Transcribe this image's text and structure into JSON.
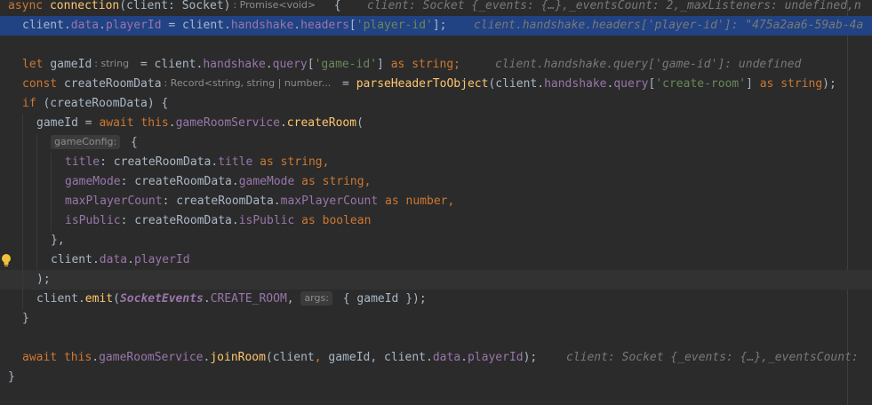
{
  "editor": {
    "code": {
      "l1": {
        "async": "async ",
        "fn": "connection",
        "params": "(client: Socket)",
        "hint": ": Promise<void>",
        "brace": "  {",
        "debug": "client: Socket {_events: {…},_eventsCount: 2,_maxListeners: undefined,n"
      },
      "l2": {
        "a": "client.",
        "b": "data",
        "c": ".",
        "d": "playerId",
        "e": " = client.",
        "f": "handshake",
        "g": ".",
        "h": "headers",
        "i": "[",
        "j": "'player-id'",
        "k": "];",
        "debug": "client.handshake.headers['player-id']: \"475a2aa6-59ab-4a"
      },
      "l4": {
        "let": "let ",
        "var": "gameId",
        "hint": ": string",
        "a": " = client.",
        "b": "handshake",
        "c": ".",
        "d": "query",
        "e": "[",
        "f": "'game-id'",
        "g": "] ",
        "as": "as ",
        "type": "string",
        "semi": ";",
        "debug": "client.handshake.query['game-id']: undefined"
      },
      "l5": {
        "const": "const ",
        "var": "createRoomData",
        "hint": ": Record<string, string | number...",
        "a": " = ",
        "fn": "parseHeaderToObject",
        "b": "(client.",
        "c": "handshake",
        "d": ".",
        "e": "query",
        "f": "[",
        "g": "'create-room'",
        "h": "] ",
        "as": "as ",
        "type": "string",
        "i": ");"
      },
      "l6": {
        "if": "if ",
        "rest": "(createRoomData) {"
      },
      "l7": {
        "a": "gameId = ",
        "await": "await ",
        "this": "this",
        "b": ".",
        "c": "gameRoomService",
        "d": ".",
        "fn": "createRoom",
        "e": "("
      },
      "l8": {
        "hint": "gameConfig:",
        "brace": " {"
      },
      "l9": {
        "key": "title",
        "a": ": createRoomData.",
        "prop": "title",
        "as": " as ",
        "type": "string",
        "comma": ","
      },
      "l10": {
        "key": "gameMode",
        "a": ": createRoomData.",
        "prop": "gameMode",
        "as": " as ",
        "type": "string",
        "comma": ","
      },
      "l11": {
        "key": "maxPlayerCount",
        "a": ": createRoomData.",
        "prop": "maxPlayerCount",
        "as": " as ",
        "type": "number",
        "comma": ","
      },
      "l12": {
        "key": "isPublic",
        "a": ": createRoomData.",
        "prop": "isPublic",
        "as": " as ",
        "type": "boolean"
      },
      "l13": {
        "text": "},"
      },
      "l14": {
        "a": "client.",
        "b": "data",
        "c": ".",
        "d": "playerId"
      },
      "l15": {
        "text": ");"
      },
      "l16": {
        "a": "client.",
        "fn": "emit",
        "b": "(",
        "cls": "SocketEvents",
        "c": ".",
        "const": "CREATE_ROOM",
        "d": ", ",
        "hint": "args:",
        "e": " { gameId });"
      },
      "l17": {
        "text": "}"
      },
      "l19": {
        "await": "await ",
        "this": "this",
        "a": ".",
        "b": "gameRoomService",
        "c": ".",
        "fn": "joinRoom",
        "d": "(client",
        "e": ", ",
        "f": "gameId",
        "g": ", client.",
        "h": "data",
        "i": ".",
        "j": "playerId",
        "k": ");",
        "debug": "client: Socket {_events: {…},_eventsCount:"
      },
      "l20": {
        "text": "}"
      }
    },
    "colors": {
      "background": "#2b2b2b",
      "selection": "#214283",
      "keyword": "#cc7832",
      "function": "#ffc66d",
      "property": "#9876aa",
      "string": "#6a8759",
      "default": "#a9b7c6"
    }
  }
}
